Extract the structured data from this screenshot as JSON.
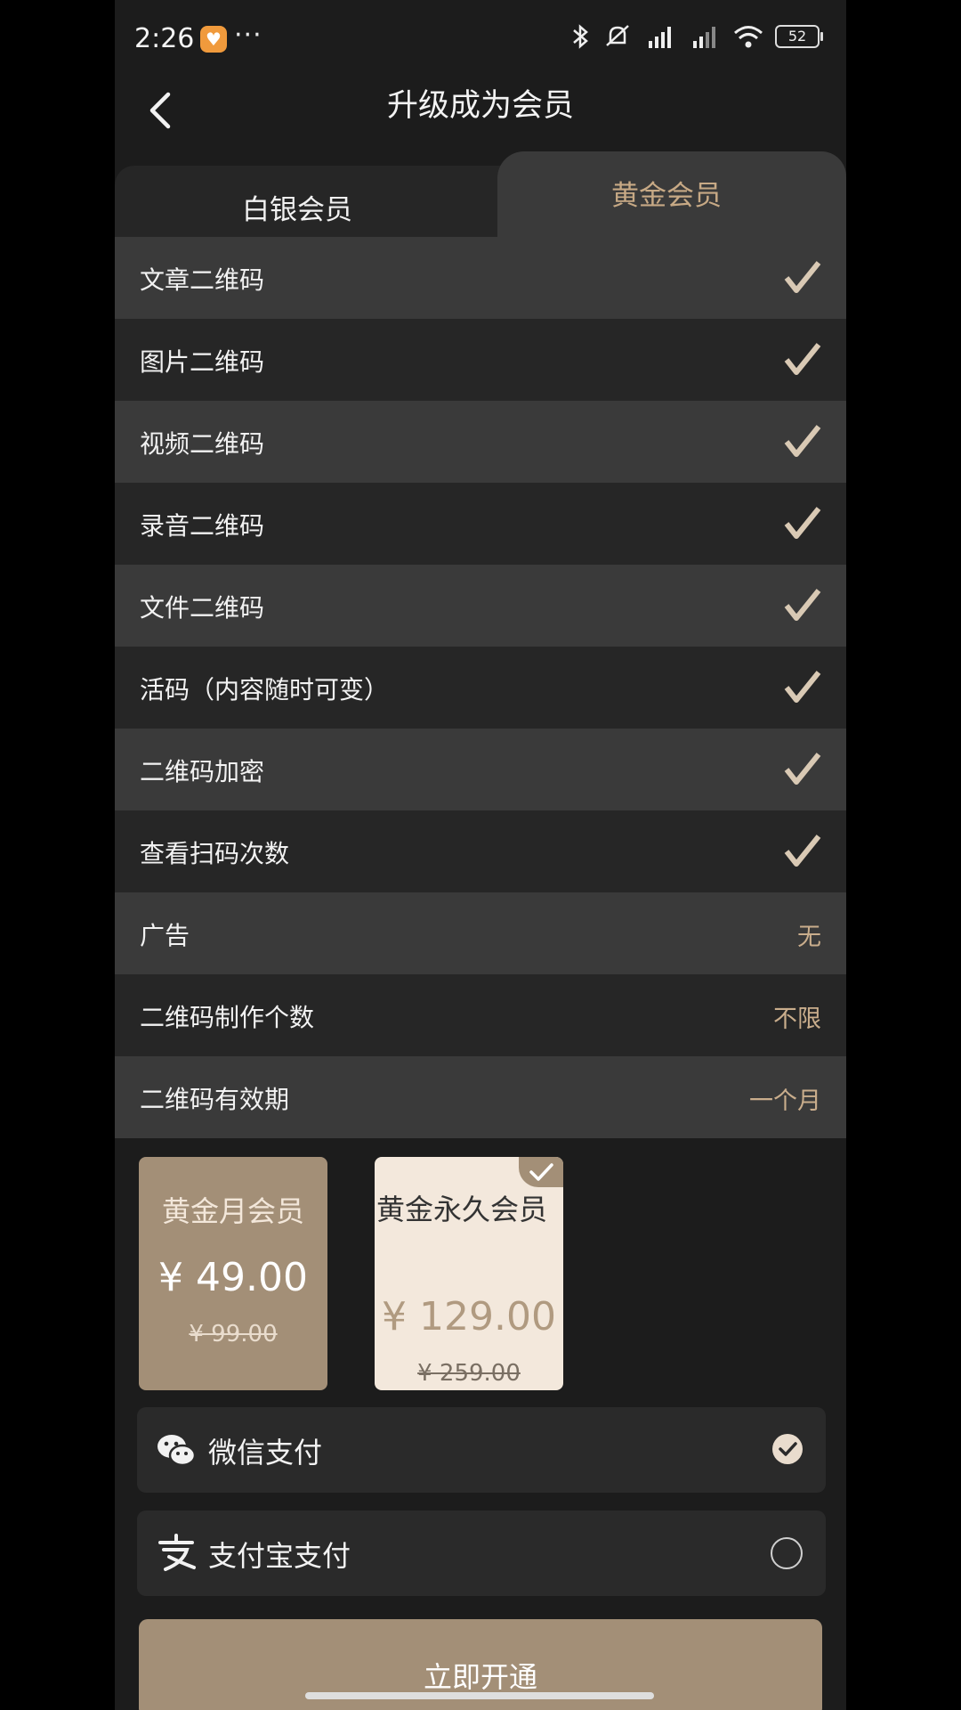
{
  "status_bar": {
    "time": "2:26",
    "dots": "···",
    "battery": "52"
  },
  "header": {
    "title": "升级成为会员"
  },
  "tabs": [
    {
      "label": "白银会员",
      "active": false
    },
    {
      "label": "黄金会员",
      "active": true
    }
  ],
  "features": [
    {
      "label": "文章二维码",
      "value": "check"
    },
    {
      "label": "图片二维码",
      "value": "check"
    },
    {
      "label": "视频二维码",
      "value": "check"
    },
    {
      "label": "录音二维码",
      "value": "check"
    },
    {
      "label": "文件二维码",
      "value": "check"
    },
    {
      "label": "活码（内容随时可变）",
      "value": "check"
    },
    {
      "label": "二维码加密",
      "value": "check"
    },
    {
      "label": "查看扫码次数",
      "value": "check"
    },
    {
      "label": "广告",
      "value": "无"
    },
    {
      "label": "二维码制作个数",
      "value": "不限"
    },
    {
      "label": "二维码有效期",
      "value": "一个月"
    }
  ],
  "plans": [
    {
      "name": "黄金月会员",
      "price": "¥ 49.00",
      "original": "¥ 99.00",
      "selected": false
    },
    {
      "name": "黄金永久会员",
      "price": "¥ 129.00",
      "original": "¥ 259.00",
      "selected": true
    }
  ],
  "payment": [
    {
      "label": "微信支付",
      "icon": "wechat-icon",
      "selected": true
    },
    {
      "label": "支付宝支付",
      "icon": "alipay-icon",
      "selected": false
    }
  ],
  "submit": {
    "label": "立即开通"
  },
  "colors": {
    "accent": "#a38f77",
    "gold_text": "#c7a985",
    "background": "#1c1c1c"
  }
}
